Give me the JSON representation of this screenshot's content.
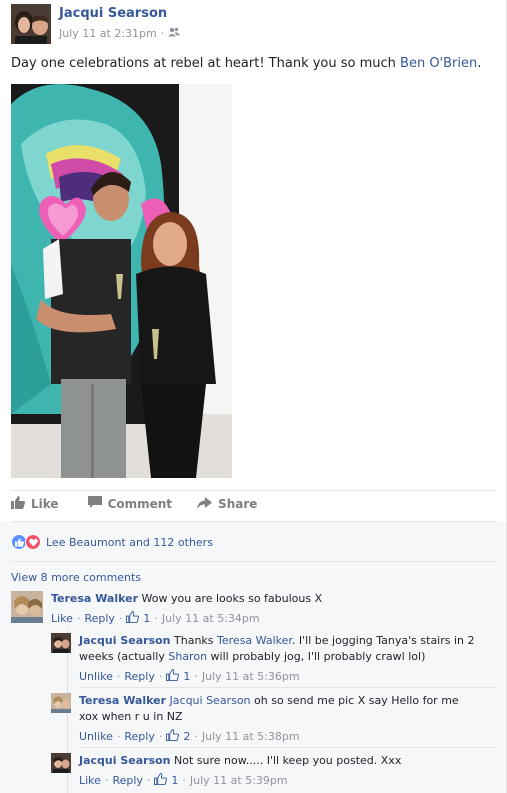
{
  "post": {
    "author": "Jacqui Searson",
    "timestamp": "July 11 at 2:31pm",
    "meta_separator": "·",
    "privacy_icon": "friends-icon",
    "text_before": "Day one celebrations at rebel at heart! Thank you so much ",
    "text_mention": "Ben O'Brien",
    "text_after": "."
  },
  "actions": {
    "like": "Like",
    "comment": "Comment",
    "share": "Share"
  },
  "reactions": {
    "summary": "Lee Beaumont and 112 others",
    "colors": {
      "like": "#5890ff",
      "love": "#f25268"
    }
  },
  "view_more": "View 8 more comments",
  "comments": [
    {
      "name": "Teresa Walker",
      "text": "Wow you are looks so fabulous X",
      "like_label": "Like",
      "reply_label": "Reply",
      "likes": "1",
      "time": "July 11 at 5:34pm"
    }
  ],
  "replies": [
    {
      "name": "Jacqui Searson",
      "text_1": "Thanks ",
      "mention_1": "Teresa Walker",
      "text_2": ". I'll be jogging Tanya's stairs in 2 weeks (actually ",
      "mention_2": "Sharon",
      "text_3": " will probably jog, I'll probably crawl lol)",
      "like_label": "Unlike",
      "reply_label": "Reply",
      "likes": "1",
      "time": "July 11 at 5:36pm"
    },
    {
      "name": "Teresa Walker",
      "mention": "Jacqui Searson",
      "text": " oh so send me pic X say Hello for me xox when r u in NZ",
      "like_label": "Unlike",
      "reply_label": "Reply",
      "likes": "2",
      "time": "July 11 at 5:38pm"
    },
    {
      "name": "Jacqui Searson",
      "text": "Not sure now..... I'll keep you posted. Xxx",
      "like_label": "Like",
      "reply_label": "Reply",
      "likes": "1",
      "time": "July 11 at 5:39pm"
    }
  ],
  "colors": {
    "link": "#365899",
    "meta": "#90949c",
    "comment_bg": "#f6f7f9"
  }
}
